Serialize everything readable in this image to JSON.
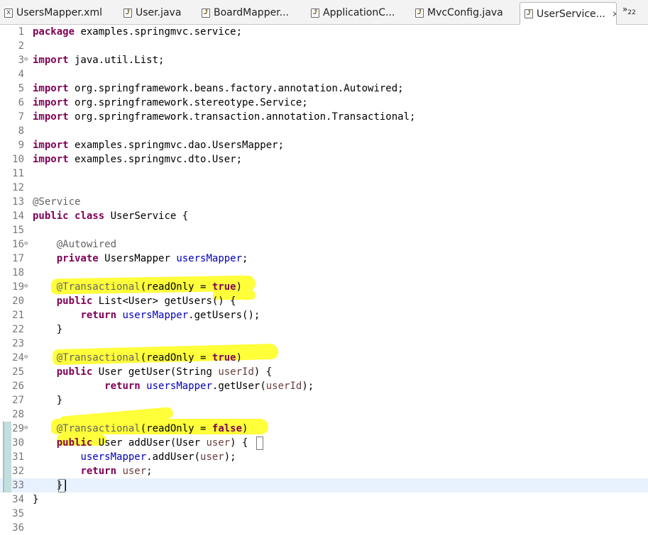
{
  "tabs": [
    {
      "label": "UsersMapper.xml",
      "icon": "xml-file-icon"
    },
    {
      "label": "User.java",
      "icon": "java-file-icon"
    },
    {
      "label": "BoardMapper...",
      "icon": "java-file-icon"
    },
    {
      "label": "ApplicationC...",
      "icon": "java-file-icon"
    },
    {
      "label": "MvcConfig.java",
      "icon": "java-file-icon"
    },
    {
      "label": "UserService...",
      "icon": "java-file-icon",
      "active": true,
      "close": "✕"
    }
  ],
  "overflow": {
    "symbol": "»",
    "count": "22"
  },
  "colors": {
    "keyword": "#7f0055",
    "annotation": "#646464",
    "field": "#0000c0",
    "parameter": "#6a3e3e",
    "highlight": "#ffff3a",
    "current_line": "#e8f2fe"
  },
  "editor": {
    "fold_marker": "⊖",
    "current_line": 33,
    "lines": [
      {
        "n": "1",
        "html": "<span class='kw'>package</span> examples.springmvc.service;"
      },
      {
        "n": "2",
        "html": ""
      },
      {
        "n": "3",
        "fold": true,
        "html": "<span class='kw'>import</span> java.util.List;"
      },
      {
        "n": "4",
        "html": ""
      },
      {
        "n": "5",
        "html": "<span class='kw'>import</span> org.springframework.beans.factory.annotation.Autowired;"
      },
      {
        "n": "6",
        "html": "<span class='kw'>import</span> org.springframework.stereotype.Service;"
      },
      {
        "n": "7",
        "html": "<span class='kw'>import</span> org.springframework.transaction.annotation.Transactional;"
      },
      {
        "n": "8",
        "html": ""
      },
      {
        "n": "9",
        "html": "<span class='kw'>import</span> examples.springmvc.dao.UsersMapper;"
      },
      {
        "n": "10",
        "html": "<span class='kw'>import</span> examples.springmvc.dto.User;"
      },
      {
        "n": "11",
        "html": ""
      },
      {
        "n": "12",
        "html": ""
      },
      {
        "n": "13",
        "html": "<span class='ann'>@Service</span>"
      },
      {
        "n": "14",
        "html": "<span class='kw'>public</span> <span class='kw'>class</span> UserService {"
      },
      {
        "n": "15",
        "html": ""
      },
      {
        "n": "16",
        "fold": true,
        "html": "    <span class='ann'>@Autowired</span>"
      },
      {
        "n": "17",
        "html": "    <span class='kw'>private</span> UsersMapper <span class='fld'>usersMapper</span>;"
      },
      {
        "n": "18",
        "html": ""
      },
      {
        "n": "19",
        "fold": true,
        "html": "    <span class='ann'>@Transactional</span>(readOnly = <span class='kw'>true</span>)"
      },
      {
        "n": "20",
        "html": "    <span class='kw'>public</span> List&lt;User&gt; getUsers() {"
      },
      {
        "n": "21",
        "html": "        <span class='kw'>return</span> <span class='fld'>usersMapper</span>.getUsers();"
      },
      {
        "n": "22",
        "html": "    }"
      },
      {
        "n": "23",
        "html": ""
      },
      {
        "n": "24",
        "fold": true,
        "html": "    <span class='ann'>@Transactional</span>(readOnly = <span class='kw'>true</span>)"
      },
      {
        "n": "25",
        "html": "    <span class='kw'>public</span> User getUser(String <span class='prm'>userId</span>) {"
      },
      {
        "n": "26",
        "html": "            <span class='kw'>return</span> <span class='fld'>usersMapper</span>.getUser(<span class='prm'>userId</span>);"
      },
      {
        "n": "27",
        "html": "    }"
      },
      {
        "n": "28",
        "html": ""
      },
      {
        "n": "29",
        "fold": true,
        "html": "    <span class='ann'>@Transactional</span>(readOnly = <span class='kw'>false</span>)"
      },
      {
        "n": "30",
        "html": "    <span class='kw'>public</span> User addUser(User <span class='prm'>user</span>) {"
      },
      {
        "n": "31",
        "html": "        <span class='fld'>usersMapper</span>.addUser(<span class='prm'>user</span>);"
      },
      {
        "n": "32",
        "html": "        <span class='kw'>return</span> <span class='prm'>user</span>;"
      },
      {
        "n": "33",
        "html": "    }"
      },
      {
        "n": "34",
        "html": "}"
      },
      {
        "n": "35",
        "html": ""
      },
      {
        "n": "36",
        "html": ""
      }
    ]
  }
}
